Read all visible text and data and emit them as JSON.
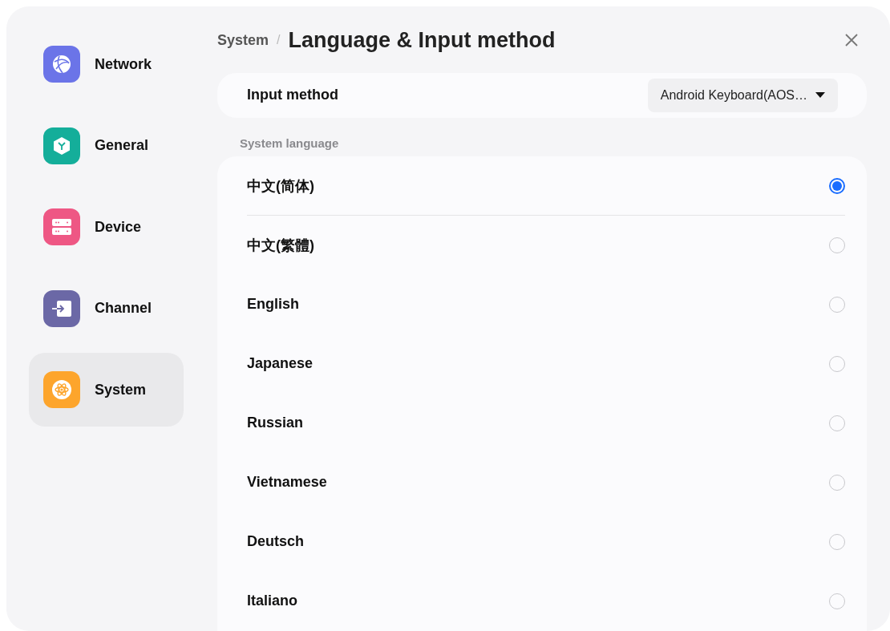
{
  "sidebar": {
    "items": [
      {
        "label": "Network",
        "color": "#6b74e8",
        "selected": false
      },
      {
        "label": "General",
        "color": "#14ae9a",
        "selected": false
      },
      {
        "label": "Device",
        "color": "#ee5784",
        "selected": false
      },
      {
        "label": "Channel",
        "color": "#6b68a6",
        "selected": false
      },
      {
        "label": "System",
        "color": "#fda52c",
        "selected": true
      }
    ]
  },
  "breadcrumb": {
    "parent": "System",
    "separator": "/",
    "title": "Language & Input method"
  },
  "input_method": {
    "label": "Input method",
    "value": "Android Keyboard(AOS…"
  },
  "system_language": {
    "heading": "System language",
    "options": [
      {
        "label": "中文(简体)",
        "selected": true
      },
      {
        "label": "中文(繁體)",
        "selected": false
      },
      {
        "label": "English",
        "selected": false
      },
      {
        "label": "Japanese",
        "selected": false
      },
      {
        "label": "Russian",
        "selected": false
      },
      {
        "label": "Vietnamese",
        "selected": false
      },
      {
        "label": "Deutsch",
        "selected": false
      },
      {
        "label": "Italiano",
        "selected": false
      }
    ]
  }
}
